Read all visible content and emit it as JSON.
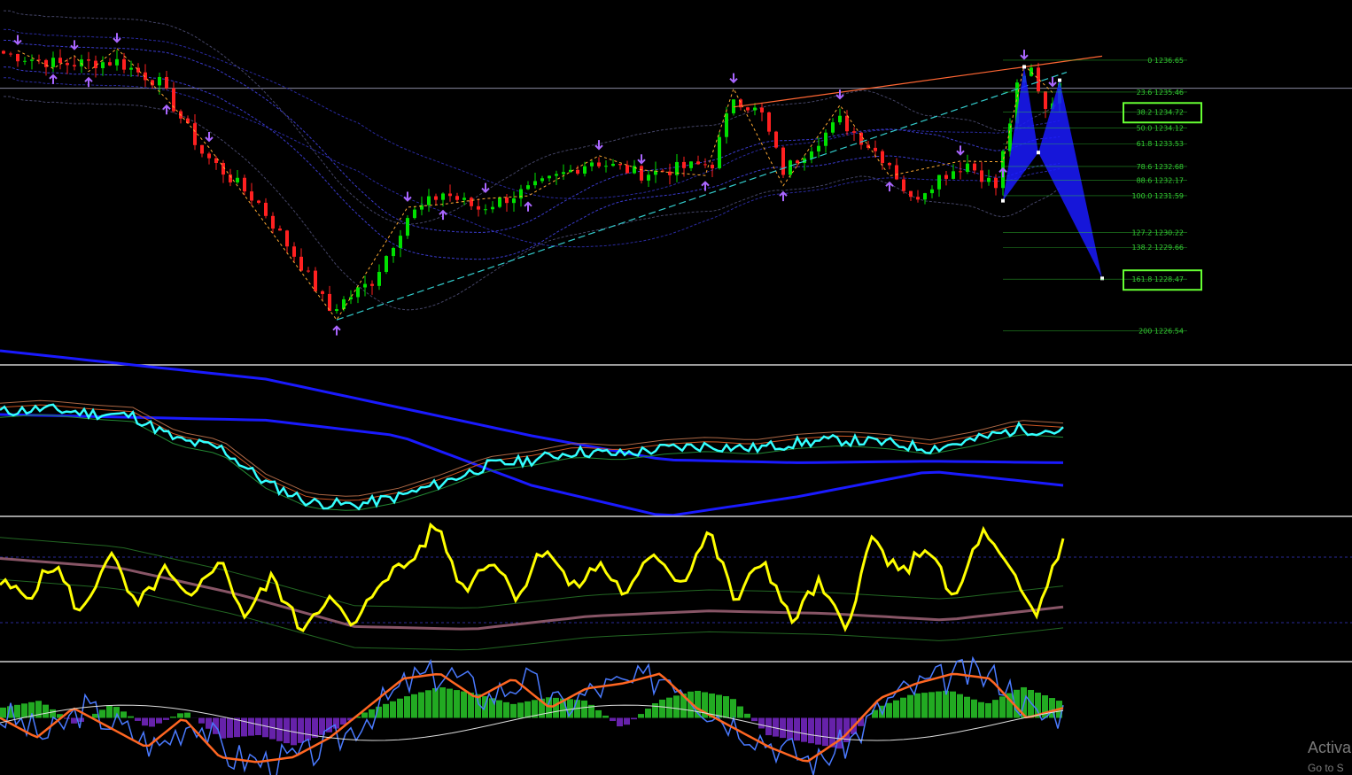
{
  "chart_data": [
    {
      "type": "line",
      "panel": "price",
      "chart_kind": "candlestick",
      "price_axis": {
        "min": 1225.5,
        "max": 1238.5
      },
      "bar_count": 150,
      "close_path": [
        [
          0,
          1236.9
        ],
        [
          8,
          1236.5
        ],
        [
          16,
          1236.6
        ],
        [
          22,
          1235.8
        ],
        [
          28,
          1233.2
        ],
        [
          36,
          1231.3
        ],
        [
          42,
          1229.0
        ],
        [
          46,
          1227.3
        ],
        [
          52,
          1228.4
        ],
        [
          57,
          1230.8
        ],
        [
          62,
          1231.7
        ],
        [
          67,
          1231.1
        ],
        [
          75,
          1231.9
        ],
        [
          83,
          1232.9
        ],
        [
          90,
          1232.4
        ],
        [
          100,
          1232.8
        ],
        [
          103,
          1235.3
        ],
        [
          107,
          1234.6
        ],
        [
          110,
          1232.5
        ],
        [
          118,
          1234.4
        ],
        [
          125,
          1232.8
        ],
        [
          128,
          1231.4
        ],
        [
          132,
          1232.3
        ],
        [
          136,
          1232.8
        ],
        [
          140,
          1231.9
        ],
        [
          143,
          1235.6
        ],
        [
          145,
          1236.3
        ],
        [
          147,
          1234.9
        ],
        [
          149,
          1235.6
        ]
      ],
      "swing_highs": [
        2,
        10,
        16,
        29,
        57,
        68,
        84,
        90,
        103,
        118,
        135,
        144,
        148
      ],
      "swing_lows": [
        7,
        12,
        23,
        47,
        62,
        74,
        99,
        110,
        125,
        141
      ],
      "harmonic_pattern": {
        "color": "#1a1aff",
        "points": [
          [
            141,
            1231.4
          ],
          [
            144,
            1236.4
          ],
          [
            146,
            1233.2
          ],
          [
            149,
            1235.9
          ],
          [
            155,
            1228.5
          ]
        ]
      },
      "fibonacci_levels": [
        {
          "ratio": "0",
          "price": "1236.65"
        },
        {
          "ratio": "23.6",
          "price": "1235.46"
        },
        {
          "ratio": "38.2",
          "price": "1234.72",
          "highlight": true
        },
        {
          "ratio": "50.0",
          "price": "1234.12"
        },
        {
          "ratio": "61.8",
          "price": "1233.53"
        },
        {
          "ratio": "78.6",
          "price": "1232.68"
        },
        {
          "ratio": "88.6",
          "price": "1232.17"
        },
        {
          "ratio": "100.0",
          "price": "1231.59"
        },
        {
          "ratio": "127.2",
          "price": "1230.22"
        },
        {
          "ratio": "138.2",
          "price": "1229.66"
        },
        {
          "ratio": "161.8",
          "price": "1228.47",
          "highlight": true
        },
        {
          "ratio": "200",
          "price": "1226.54"
        }
      ],
      "colors": {
        "up": "#00e000",
        "down": "#ff2020",
        "fib": "#33cc33",
        "highlight_box": "#66ff33",
        "trendline": "#ff6633",
        "channel": "#33cccc",
        "zigzag": "#ffaa33"
      }
    },
    {
      "type": "line",
      "panel": "indicator-1",
      "main_line_color": "#33ffff",
      "band_color": "#1a1aff",
      "main_line": [
        0.72,
        0.74,
        0.71,
        0.69,
        0.52,
        0.46,
        0.22,
        0.08,
        0.06,
        0.12,
        0.22,
        0.34,
        0.38,
        0.44,
        0.42,
        0.46,
        0.48,
        0.46,
        0.5,
        0.52,
        0.5,
        0.46,
        0.52,
        0.6,
        0.58
      ]
    },
    {
      "type": "line",
      "panel": "indicator-2",
      "main_line_color": "#ffff00",
      "signal_color": "#cc6688",
      "levels": [
        0.75,
        0.25
      ],
      "main_line": [
        0.55,
        0.45,
        0.7,
        0.3,
        0.8,
        0.35,
        0.65,
        0.4,
        0.75,
        0.3,
        0.6,
        0.2,
        0.45,
        0.2,
        0.6,
        0.7,
        1.0,
        0.5,
        0.75,
        0.45,
        0.85,
        0.5,
        0.7,
        0.45,
        0.8,
        0.55,
        0.95,
        0.4,
        0.75,
        0.25,
        0.55,
        0.2,
        0.9,
        0.6,
        0.85,
        0.4,
        0.95,
        0.65,
        0.3,
        0.9
      ]
    },
    {
      "type": "bar",
      "panel": "indicator-3",
      "histogram_colors": {
        "positive": "#22aa22",
        "negative": "#6622aa"
      },
      "histogram": [
        0.3,
        0.5,
        -0.2,
        0.4,
        -0.3,
        0.2,
        -0.6,
        -0.5,
        -0.8,
        -0.4,
        0.2,
        0.6,
        0.9,
        0.7,
        0.4,
        0.6,
        0.5,
        -0.3,
        0.5,
        0.8,
        0.6,
        -0.5,
        -0.7,
        -0.9,
        0.3,
        0.7,
        0.8,
        0.4,
        0.9,
        0.5
      ],
      "oscillator": [
        0.5,
        0.3,
        0.6,
        0.4,
        0.2,
        0.5,
        0.1,
        0.05,
        0.1,
        0.3,
        0.6,
        0.9,
        0.95,
        0.7,
        0.9,
        0.6,
        0.8,
        0.85,
        0.95,
        0.6,
        0.4,
        0.2,
        0.05,
        0.3,
        0.7,
        0.85,
        0.95,
        0.9,
        0.5,
        0.6
      ]
    }
  ],
  "watermark": {
    "title": "Activa",
    "subtitle": "Go to S"
  }
}
